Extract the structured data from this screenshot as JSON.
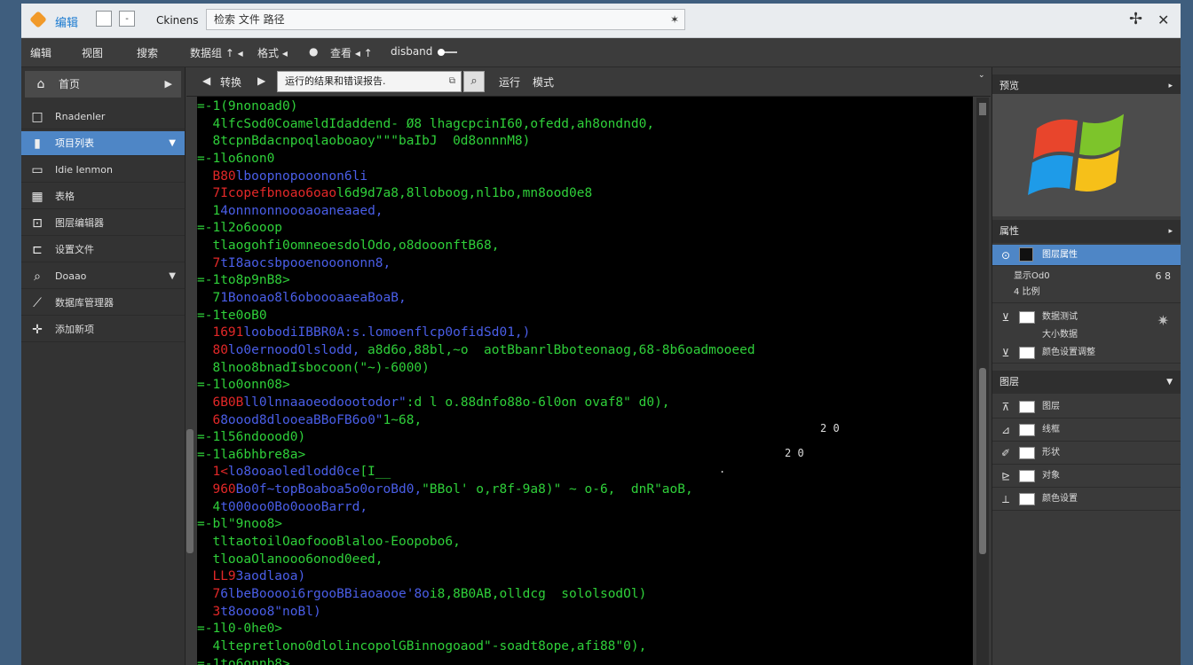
{
  "titlebar": {
    "app_title": "编辑",
    "btn_min": "",
    "btn_dash": "-",
    "label": "Ckinens",
    "address": "检索 文件 路径",
    "address_icon": "✶",
    "ctl_move": "✢",
    "ctl_close": "✕"
  },
  "menubar": {
    "items": [
      "编辑",
      "视图",
      "搜索",
      "数据组 ↑ ◂",
      "格式 ◂",
      "●",
      "查看 ◂ ↑",
      "disband"
    ]
  },
  "sidebar": {
    "header": "首页",
    "header_arrow": "▶",
    "items": [
      {
        "icon": "□",
        "label": "Rnadenler",
        "arrow": ""
      },
      {
        "icon": "▮",
        "label": "项目列表",
        "arrow": "▼"
      },
      {
        "icon": "▭",
        "label": "Idie Ienmon",
        "arrow": ""
      },
      {
        "icon": "▦",
        "label": "表格",
        "arrow": ""
      },
      {
        "icon": "⊡",
        "label": "图层编辑器",
        "arrow": ""
      },
      {
        "icon": "⊏",
        "label": "设置文件",
        "arrow": ""
      },
      {
        "icon": "⌕",
        "label": "Doaao",
        "arrow": "▼"
      },
      {
        "icon": "⟋",
        "label": "数据库管理器",
        "arrow": ""
      },
      {
        "icon": "✛",
        "label": "添加新项",
        "arrow": ""
      }
    ]
  },
  "editor_toolbar": {
    "back": "◀",
    "back_label": "转换",
    "forward": "▶",
    "search_value": "运行的结果和错误报告.",
    "search_icon": "⌕",
    "run_label": "运行",
    "mode_label": "模式"
  },
  "code": {
    "lines": [
      [
        {
          "c": "g",
          "t": "=-1(9nonoad0)"
        }
      ],
      [
        {
          "c": "g",
          "t": "  4lfcSod0CoameldIdaddend- Ø8 lhagcpcinI60,ofedd,ah8ondnd0,"
        }
      ],
      [
        {
          "c": "g",
          "t": "  8tcpnBdacnpoqlaoboaoy\"\"\"baIbJ  0d8onnnM8)"
        }
      ],
      [
        {
          "c": "g",
          "t": "=-1lo6non0"
        }
      ],
      [
        {
          "c": "r",
          "t": "  B80"
        },
        {
          "c": "b",
          "t": "lboopnopooonon6li"
        }
      ],
      [
        {
          "c": "r",
          "t": "  7Icopefbnoao6oao"
        },
        {
          "c": "g",
          "t": "l6d9d7a8,8lloboog,nl1bo,mn8ood0e8"
        }
      ],
      [
        {
          "c": "g",
          "t": "  1"
        },
        {
          "c": "b",
          "t": "4onnnonnoooaoaneaaed,"
        }
      ],
      [
        {
          "c": "g",
          "t": "=-1l2o6ooop"
        }
      ],
      [
        {
          "c": "g",
          "t": "  tlaogohfi0omneoesdolOdo,o8dooonftB68,"
        }
      ],
      [
        {
          "c": "r",
          "t": "  7"
        },
        {
          "c": "b",
          "t": "tI8aocsbpooenooononn8,"
        }
      ],
      [
        {
          "c": "g",
          "t": "=-1to8p9nB8>"
        }
      ],
      [
        {
          "c": "g",
          "t": "  7"
        },
        {
          "c": "b",
          "t": "1Bonoao8l6oboooaaeaBoaB,"
        }
      ],
      [
        {
          "c": "g",
          "t": "=-1te0oB0"
        }
      ],
      [
        {
          "c": "r",
          "t": "  1691"
        },
        {
          "c": "b",
          "t": "loobodiIBBR0A:s.lomoenflcp0ofidSd01,)"
        }
      ],
      [
        {
          "c": "r",
          "t": "  80"
        },
        {
          "c": "b",
          "t": "lo0ernoodOlslodd,"
        },
        {
          "c": "g",
          "t": " a8d6o,88bl,~o  aotBbanrlBboteonaog,68-8b6oadmooeed"
        }
      ],
      [
        {
          "c": "g",
          "t": "  8lnoo8bnadIsbocoon(\"~)-6000)"
        }
      ],
      [
        {
          "c": "g",
          "t": "=-1lo0onn08>"
        }
      ],
      [
        {
          "c": "r",
          "t": "  6B0B"
        },
        {
          "c": "b",
          "t": "ll0lnnaaoeodoootodor\""
        },
        {
          "c": "g",
          "t": ":d l o.88dnfo88o-6l0on ovaf8\" d0),"
        }
      ],
      [
        {
          "c": "r",
          "t": "  6"
        },
        {
          "c": "b",
          "t": "8oood8dlooeaBBoFB6o0\""
        },
        {
          "c": "g",
          "t": "1~68,"
        }
      ],
      [
        {
          "c": "g",
          "t": "=-1l56ndoood0)"
        }
      ],
      [
        {
          "c": "g",
          "t": "=-1la6bhbre8a>"
        }
      ],
      [
        {
          "c": "r",
          "t": "  1<"
        },
        {
          "c": "b",
          "t": "lo8ooaoledlodd0ce"
        },
        {
          "c": "g",
          "t": "[I__"
        }
      ],
      [
        {
          "c": "r",
          "t": "  960"
        },
        {
          "c": "b",
          "t": "Bo0f~topBoaboa5o0oroBd0,"
        },
        {
          "c": "g",
          "t": "\"BBol' o,r8f-9a8)\" ~ o-6,  dnR\"aoB,"
        }
      ],
      [
        {
          "c": "g",
          "t": "  4"
        },
        {
          "c": "b",
          "t": "t000oo0Bo0oooBarrd,"
        }
      ],
      [
        {
          "c": "g",
          "t": "=-bl\"9noo8>"
        }
      ],
      [
        {
          "c": "g",
          "t": "  tltaotoilOaofoooBlaloo-Eoopobo6,"
        }
      ],
      [
        {
          "c": "g",
          "t": "  tlooaOlanooo6onod0eed,"
        }
      ],
      [
        {
          "c": "r",
          "t": "  LL9"
        },
        {
          "c": "b",
          "t": "3aodlaoa)"
        }
      ],
      [
        {
          "c": "r",
          "t": "  7"
        },
        {
          "c": "b",
          "t": "6lbeBooooi6rgooBBiaoaooe'8o"
        },
        {
          "c": "g",
          "t": "i8,8B0AB,olldcg  sololsodOl)"
        }
      ],
      [
        {
          "c": "r",
          "t": "  3"
        },
        {
          "c": "b",
          "t": "t8oooo8\"noBl)"
        }
      ],
      [
        {
          "c": "g",
          "t": "=-1l0-0he0>"
        }
      ],
      [
        {
          "c": "g",
          "t": "  4ltepretlono0dlolincopolGBinnogoaod\"-soadt8ope,afi88\"0),"
        }
      ],
      [
        {
          "c": "g",
          "t": "=-1to6onnb8>"
        }
      ]
    ],
    "stray1": "2      0",
    "stray2": "2             0",
    "stray3": "."
  },
  "rpanel": {
    "header1": "预览",
    "header1_dd": "▸",
    "header2": "属性",
    "header2_dd": "▸",
    "header3": "图层",
    "header3_dd": "▼",
    "props": [
      {
        "icon": "⊙",
        "label": "图层属性",
        "value": "",
        "check": false,
        "sel": true
      },
      {
        "icon": "",
        "label": "显示Od0",
        "value": "6 8",
        "check": false,
        "sel": false
      },
      {
        "icon": "",
        "label": "4 比例",
        "value": "",
        "check": false,
        "sel": false
      },
      {
        "icon": "⊻",
        "label": "数据测试",
        "value": "",
        "check": true,
        "sel": false
      },
      {
        "icon": "",
        "label": "大小数据",
        "value": "",
        "check": false,
        "sel": false
      },
      {
        "icon": "⊻",
        "label": "颜色设置调整",
        "value": "",
        "check": true,
        "sel": false
      }
    ],
    "pin_icon": "✷",
    "layers": [
      {
        "icon": "⊼",
        "label": "图层"
      },
      {
        "icon": "⊿",
        "label": "线框"
      },
      {
        "icon": "✐",
        "label": "形状"
      },
      {
        "icon": "⊵",
        "label": "对象"
      },
      {
        "icon": "⟂",
        "label": "颜色设置"
      }
    ]
  },
  "colors": {
    "code_green": "#2fd03a",
    "code_red": "#e22828",
    "code_blue": "#4a5ee8",
    "selection": "#4e86c6",
    "accent": "#1c7bd0"
  }
}
